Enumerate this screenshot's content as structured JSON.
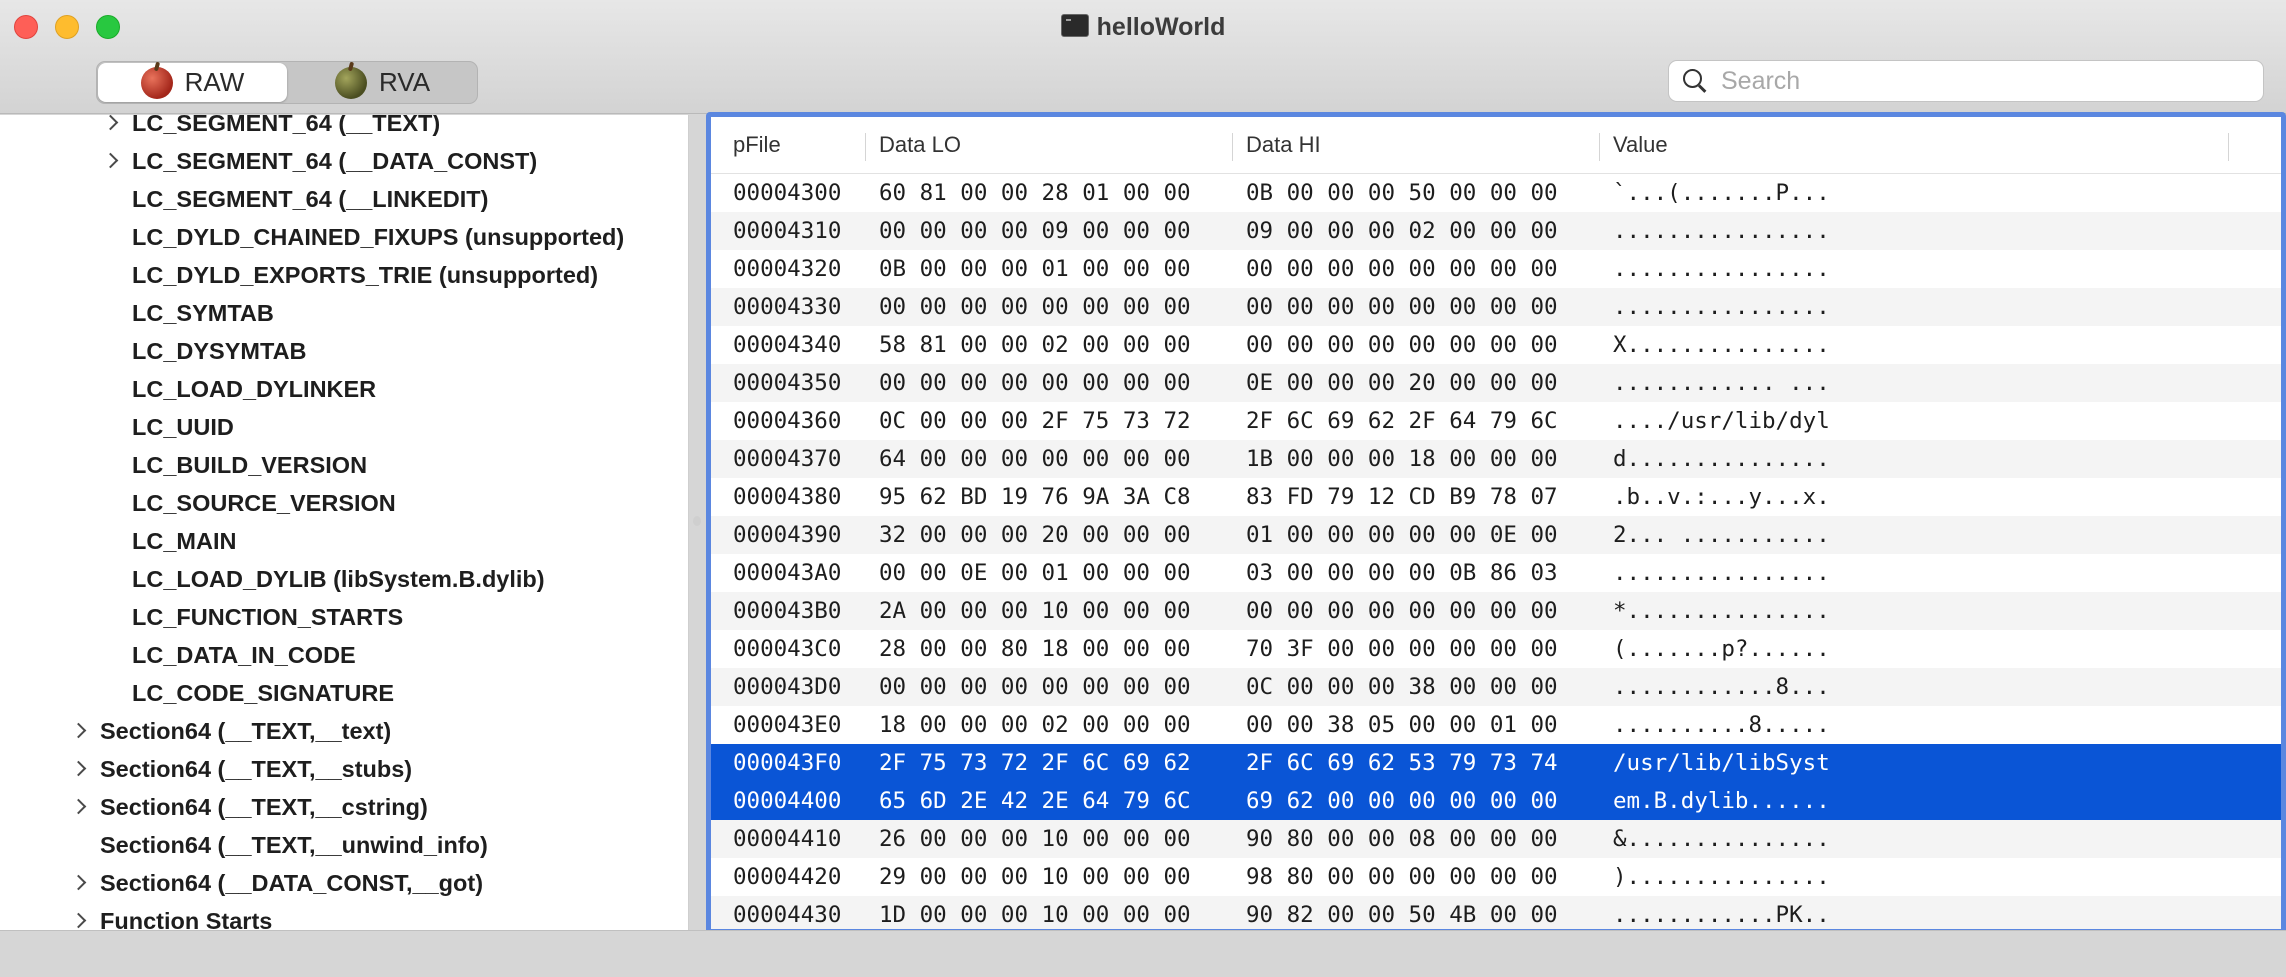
{
  "window": {
    "title": "helloWorld"
  },
  "toolbar": {
    "modes": [
      {
        "label": "RAW",
        "selected": true
      },
      {
        "label": "RVA",
        "selected": false
      }
    ],
    "search": {
      "placeholder": "Search",
      "value": ""
    }
  },
  "sidebar": {
    "items": [
      {
        "label": "LC_SEGMENT_64 (__TEXT)",
        "indent": 1,
        "expandable": true
      },
      {
        "label": "LC_SEGMENT_64 (__DATA_CONST)",
        "indent": 1,
        "expandable": true
      },
      {
        "label": "LC_SEGMENT_64 (__LINKEDIT)",
        "indent": 1,
        "expandable": false
      },
      {
        "label": "LC_DYLD_CHAINED_FIXUPS (unsupported)",
        "indent": 1,
        "expandable": false
      },
      {
        "label": "LC_DYLD_EXPORTS_TRIE (unsupported)",
        "indent": 1,
        "expandable": false
      },
      {
        "label": "LC_SYMTAB",
        "indent": 1,
        "expandable": false
      },
      {
        "label": "LC_DYSYMTAB",
        "indent": 1,
        "expandable": false
      },
      {
        "label": "LC_LOAD_DYLINKER",
        "indent": 1,
        "expandable": false
      },
      {
        "label": "LC_UUID",
        "indent": 1,
        "expandable": false
      },
      {
        "label": "LC_BUILD_VERSION",
        "indent": 1,
        "expandable": false
      },
      {
        "label": "LC_SOURCE_VERSION",
        "indent": 1,
        "expandable": false
      },
      {
        "label": "LC_MAIN",
        "indent": 1,
        "expandable": false
      },
      {
        "label": "LC_LOAD_DYLIB (libSystem.B.dylib)",
        "indent": 1,
        "expandable": false
      },
      {
        "label": "LC_FUNCTION_STARTS",
        "indent": 1,
        "expandable": false
      },
      {
        "label": "LC_DATA_IN_CODE",
        "indent": 1,
        "expandable": false
      },
      {
        "label": "LC_CODE_SIGNATURE",
        "indent": 1,
        "expandable": false
      },
      {
        "label": "Section64 (__TEXT,__text)",
        "indent": 0,
        "expandable": true
      },
      {
        "label": "Section64 (__TEXT,__stubs)",
        "indent": 0,
        "expandable": true
      },
      {
        "label": "Section64 (__TEXT,__cstring)",
        "indent": 0,
        "expandable": true
      },
      {
        "label": "Section64 (__TEXT,__unwind_info)",
        "indent": 0,
        "expandable": false
      },
      {
        "label": "Section64 (__DATA_CONST,__got)",
        "indent": 0,
        "expandable": true
      },
      {
        "label": "Function Starts",
        "indent": 0,
        "expandable": true
      }
    ]
  },
  "table": {
    "columns": [
      "pFile",
      "Data LO",
      "Data HI",
      "Value"
    ],
    "rows": [
      {
        "pfile": "00004300",
        "lo": "60 81 00 00 28 01 00 00",
        "hi": "0B 00 00 00 50 00 00 00",
        "value": "`...(.......P..."
      },
      {
        "pfile": "00004310",
        "lo": "00 00 00 00 09 00 00 00",
        "hi": "09 00 00 00 02 00 00 00",
        "value": "................"
      },
      {
        "pfile": "00004320",
        "lo": "0B 00 00 00 01 00 00 00",
        "hi": "00 00 00 00 00 00 00 00",
        "value": "................"
      },
      {
        "pfile": "00004330",
        "lo": "00 00 00 00 00 00 00 00",
        "hi": "00 00 00 00 00 00 00 00",
        "value": "................"
      },
      {
        "pfile": "00004340",
        "lo": "58 81 00 00 02 00 00 00",
        "hi": "00 00 00 00 00 00 00 00",
        "value": "X..............."
      },
      {
        "pfile": "00004350",
        "lo": "00 00 00 00 00 00 00 00",
        "hi": "0E 00 00 00 20 00 00 00",
        "value": "............ ..."
      },
      {
        "pfile": "00004360",
        "lo": "0C 00 00 00 2F 75 73 72",
        "hi": "2F 6C 69 62 2F 64 79 6C",
        "value": "..../usr/lib/dyl"
      },
      {
        "pfile": "00004370",
        "lo": "64 00 00 00 00 00 00 00",
        "hi": "1B 00 00 00 18 00 00 00",
        "value": "d..............."
      },
      {
        "pfile": "00004380",
        "lo": "95 62 BD 19 76 9A 3A C8",
        "hi": "83 FD 79 12 CD B9 78 07",
        "value": ".b..v.:...y...x."
      },
      {
        "pfile": "00004390",
        "lo": "32 00 00 00 20 00 00 00",
        "hi": "01 00 00 00 00 00 0E 00",
        "value": "2... ..........."
      },
      {
        "pfile": "000043A0",
        "lo": "00 00 0E 00 01 00 00 00",
        "hi": "03 00 00 00 00 0B 86 03",
        "value": "................"
      },
      {
        "pfile": "000043B0",
        "lo": "2A 00 00 00 10 00 00 00",
        "hi": "00 00 00 00 00 00 00 00",
        "value": "*..............."
      },
      {
        "pfile": "000043C0",
        "lo": "28 00 00 80 18 00 00 00",
        "hi": "70 3F 00 00 00 00 00 00",
        "value": "(.......p?......"
      },
      {
        "pfile": "000043D0",
        "lo": "00 00 00 00 00 00 00 00",
        "hi": "0C 00 00 00 38 00 00 00",
        "value": "............8..."
      },
      {
        "pfile": "000043E0",
        "lo": "18 00 00 00 02 00 00 00",
        "hi": "00 00 38 05 00 00 01 00",
        "value": "..........8....."
      },
      {
        "pfile": "000043F0",
        "lo": "2F 75 73 72 2F 6C 69 62",
        "hi": "2F 6C 69 62 53 79 73 74",
        "value": "/usr/lib/libSyst",
        "selected": true
      },
      {
        "pfile": "00004400",
        "lo": "65 6D 2E 42 2E 64 79 6C",
        "hi": "69 62 00 00 00 00 00 00",
        "value": "em.B.dylib......",
        "selected": true
      },
      {
        "pfile": "00004410",
        "lo": "26 00 00 00 10 00 00 00",
        "hi": "90 80 00 00 08 00 00 00",
        "value": "&..............."
      },
      {
        "pfile": "00004420",
        "lo": "29 00 00 00 10 00 00 00",
        "hi": "98 80 00 00 00 00 00 00",
        "value": ")..............."
      },
      {
        "pfile": "00004430",
        "lo": "1D 00 00 00 10 00 00 00",
        "hi": "90 82 00 00 50 4B 00 00",
        "value": "............PK.."
      }
    ]
  },
  "colors": {
    "selection": "#0a55d6",
    "focus_ring": "#5b87e0",
    "alt_row": "#f4f4f4"
  }
}
